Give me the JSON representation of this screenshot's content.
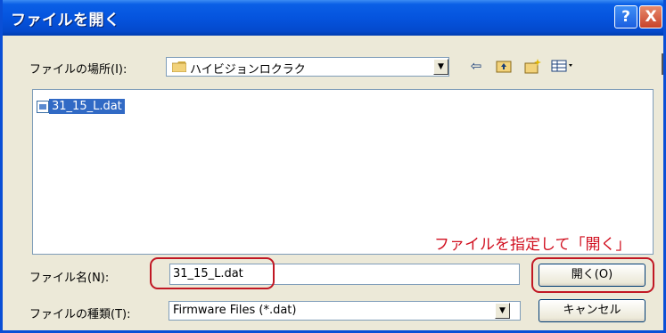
{
  "window": {
    "title": "ファイルを開く",
    "help_label": "?",
    "close_label": "X"
  },
  "lookin": {
    "label": "ファイルの場所(I):",
    "value": "ハイビジョンロクラク"
  },
  "toolbar": {
    "icons": [
      "back-icon",
      "up-folder-icon",
      "new-folder-icon",
      "view-menu-icon"
    ]
  },
  "files": [
    {
      "name": "31_15_L.dat",
      "selected": true
    }
  ],
  "annotation": "ファイルを指定して「開く」",
  "filename": {
    "label": "ファイル名(N):",
    "value": "31_15_L.dat"
  },
  "filetype": {
    "label": "ファイルの種類(T):",
    "value": "Firmware Files (*.dat)"
  },
  "buttons": {
    "open": "開く(O)",
    "cancel": "キャンセル"
  },
  "colors": {
    "titlebar": "#0554de",
    "selection": "#316ac5",
    "annotation": "#d10f1f"
  }
}
